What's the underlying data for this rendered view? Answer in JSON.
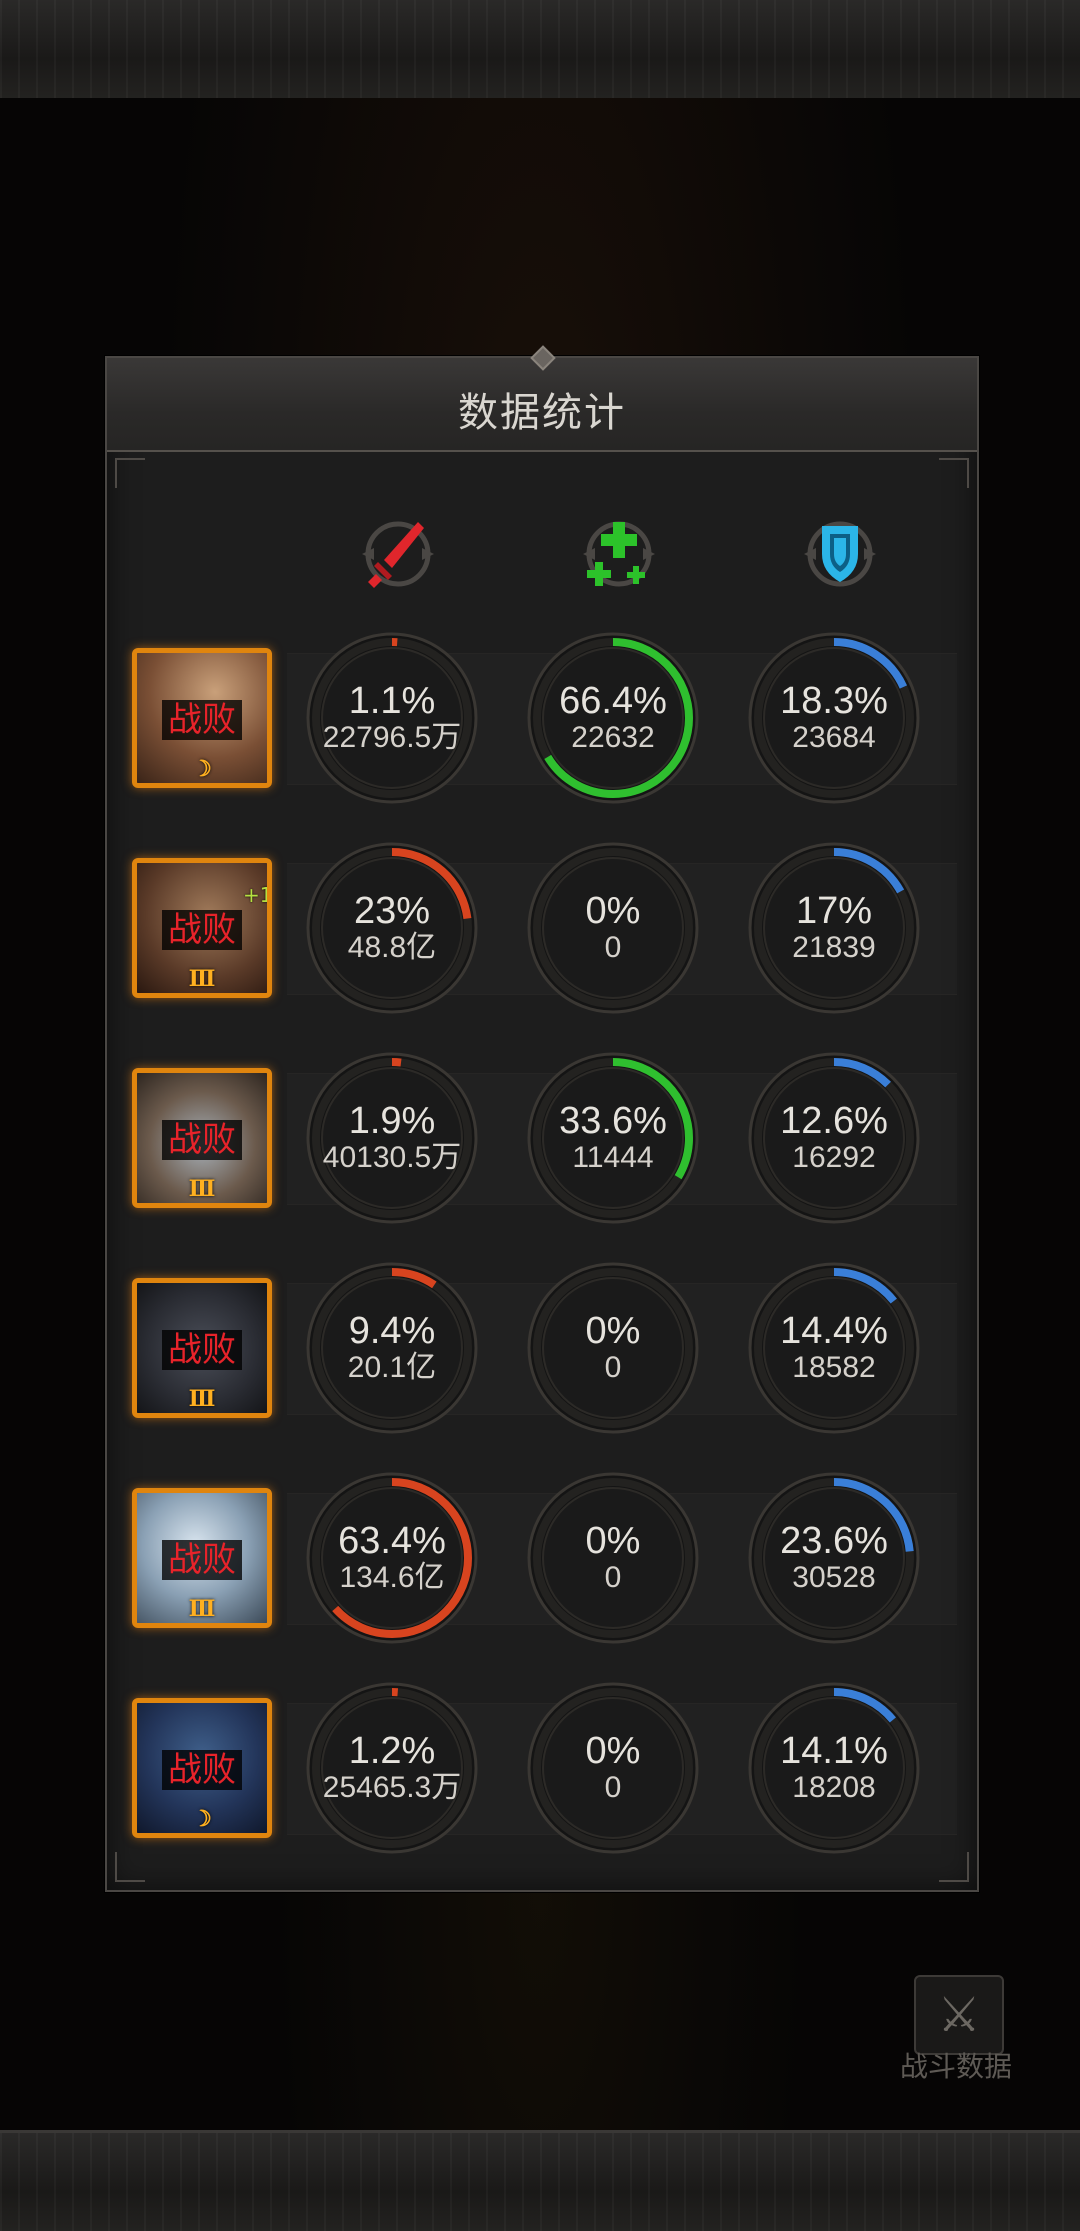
{
  "panel": {
    "title": "数据统计"
  },
  "columns": [
    {
      "icon": "red-sword-damage-icon",
      "color": "#e0262c"
    },
    {
      "icon": "green-cross-heal-icon",
      "color": "#2cc22a"
    },
    {
      "icon": "blue-shield-defense-icon",
      "color": "#2bb5e8"
    }
  ],
  "arc_colors": {
    "damage": "#d8441f",
    "heal": "#2fbf2f",
    "taken": "#3a7fd8"
  },
  "rows": [
    {
      "status": "战败",
      "badge": "moon",
      "damage": {
        "pct": "1.1%",
        "value": "22796.5万",
        "fraction": 0.011
      },
      "heal": {
        "pct": "66.4%",
        "value": "22632",
        "fraction": 0.664
      },
      "taken": {
        "pct": "18.3%",
        "value": "23684",
        "fraction": 0.183
      }
    },
    {
      "status": "战败",
      "badge": "Ⅲ",
      "plus": "+1",
      "damage": {
        "pct": "23%",
        "value": "48.8亿",
        "fraction": 0.23
      },
      "heal": {
        "pct": "0%",
        "value": "0",
        "fraction": 0
      },
      "taken": {
        "pct": "17%",
        "value": "21839",
        "fraction": 0.17
      }
    },
    {
      "status": "战败",
      "badge": "Ⅲ",
      "damage": {
        "pct": "1.9%",
        "value": "40130.5万",
        "fraction": 0.019
      },
      "heal": {
        "pct": "33.6%",
        "value": "11444",
        "fraction": 0.336
      },
      "taken": {
        "pct": "12.6%",
        "value": "16292",
        "fraction": 0.126
      }
    },
    {
      "status": "战败",
      "badge": "Ⅲ",
      "damage": {
        "pct": "9.4%",
        "value": "20.1亿",
        "fraction": 0.094
      },
      "heal": {
        "pct": "0%",
        "value": "0",
        "fraction": 0
      },
      "taken": {
        "pct": "14.4%",
        "value": "18582",
        "fraction": 0.144
      }
    },
    {
      "status": "战败",
      "badge": "Ⅲ",
      "damage": {
        "pct": "63.4%",
        "value": "134.6亿",
        "fraction": 0.634
      },
      "heal": {
        "pct": "0%",
        "value": "0",
        "fraction": 0
      },
      "taken": {
        "pct": "23.6%",
        "value": "30528",
        "fraction": 0.236
      }
    },
    {
      "status": "战败",
      "badge": "moon",
      "damage": {
        "pct": "1.2%",
        "value": "25465.3万",
        "fraction": 0.012
      },
      "heal": {
        "pct": "0%",
        "value": "0",
        "fraction": 0
      },
      "taken": {
        "pct": "14.1%",
        "value": "18208",
        "fraction": 0.141
      }
    }
  ],
  "background": {
    "battle_data_label": "战斗数据"
  }
}
